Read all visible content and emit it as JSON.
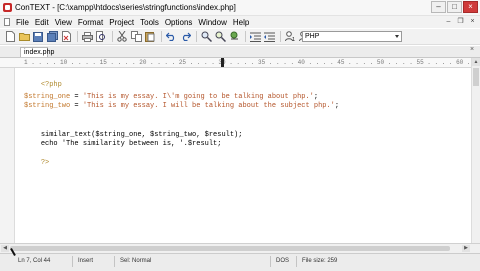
{
  "window": {
    "title": "ConTEXT - [C:\\xampp\\htdocs\\series\\stringfunctions\\index.php]"
  },
  "menu": {
    "items": [
      "File",
      "Edit",
      "View",
      "Format",
      "Project",
      "Tools",
      "Options",
      "Window",
      "Help"
    ]
  },
  "toolbar": {
    "language": "PHP"
  },
  "tabs": [
    {
      "label": "index.php"
    }
  ],
  "ruler": {
    "text": "1 . . . . 10 . . . . 15 . . . . 20 . . . . 25 . . . . 30 . . . . 35 . . . . 40 . . . . 45 . . . . 50 . . . . 55 . . . . 60 . . . . 65 . . . . 70 . . . . 75"
  },
  "code": {
    "lines": [
      {
        "tag": "<?php"
      },
      {
        "var": "$string_one",
        "op": " = ",
        "str": "'This is my essay. I\\'m going to be talking about php.'",
        "end": ";"
      },
      {
        "var": "$string_two",
        "op": " = ",
        "str": "'This is my essay. I will be talking about the subject php.'",
        "end": ";"
      },
      {
        "text": "similar_text($string_one, $string_two, $result);"
      },
      {
        "text": "echo 'The similarity between is, '.$result;"
      },
      {
        "tag": "?>"
      }
    ]
  },
  "status": {
    "position": "Ln 7, Col 44",
    "mode": "Insert",
    "selection": "Sel: Normal",
    "format": "DOS",
    "file_size": "File size: 259"
  },
  "colors": {
    "tag": "#b08a2e",
    "variable": "#c2772b",
    "string": "#b4552a",
    "close_button": "#cf3b3b"
  }
}
